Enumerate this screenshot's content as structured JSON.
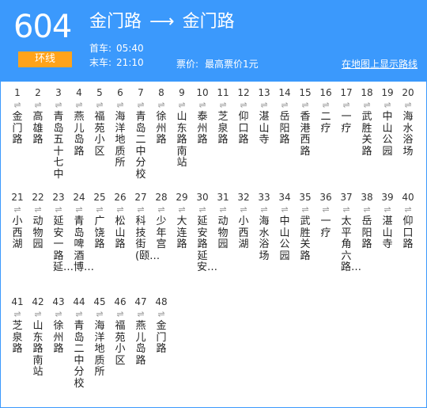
{
  "route": {
    "number": "604",
    "type_badge": "环线",
    "from": "金门路",
    "to": "金门路",
    "arrow": "⟶",
    "first_label": "首车:",
    "first_time": "05:40",
    "last_label": "末车:",
    "last_time": "21:10",
    "fare_label": "票价:",
    "fare_value": "最高票价1元",
    "map_link": "在地图上显示路线"
  },
  "direction_symbol": "⇌",
  "colors": {
    "header_bg": "#3b99fc",
    "badge_bg": "#ffa31a"
  },
  "stops": [
    {
      "n": "1",
      "name": "金门路"
    },
    {
      "n": "2",
      "name": "高雄路"
    },
    {
      "n": "3",
      "name": "青岛五十七中"
    },
    {
      "n": "4",
      "name": "燕儿岛路"
    },
    {
      "n": "5",
      "name": "福苑小区"
    },
    {
      "n": "6",
      "name": "海洋地质所"
    },
    {
      "n": "7",
      "name": "青岛二中分校"
    },
    {
      "n": "8",
      "name": "徐州路"
    },
    {
      "n": "9",
      "name": "山东路南站"
    },
    {
      "n": "10",
      "name": "泰州路"
    },
    {
      "n": "11",
      "name": "芝泉路"
    },
    {
      "n": "12",
      "name": "仰口路"
    },
    {
      "n": "13",
      "name": "湛山寺"
    },
    {
      "n": "14",
      "name": "岳阳路"
    },
    {
      "n": "15",
      "name": "香港西路"
    },
    {
      "n": "16",
      "name": "二疗"
    },
    {
      "n": "17",
      "name": "一疗"
    },
    {
      "n": "18",
      "name": "武胜关路"
    },
    {
      "n": "19",
      "name": "中山公园"
    },
    {
      "n": "20",
      "name": "海水浴场"
    },
    {
      "n": "21",
      "name": "小西湖"
    },
    {
      "n": "22",
      "name": "动物园"
    },
    {
      "n": "23",
      "name": "延安一路延…"
    },
    {
      "n": "24",
      "name": "青岛啤酒博…"
    },
    {
      "n": "25",
      "name": "广饶路"
    },
    {
      "n": "26",
      "name": "松山路"
    },
    {
      "n": "27",
      "name": "科技街(颐…"
    },
    {
      "n": "28",
      "name": "少年宫"
    },
    {
      "n": "29",
      "name": "大连路"
    },
    {
      "n": "30",
      "name": "延安路延安…"
    },
    {
      "n": "31",
      "name": "动物园"
    },
    {
      "n": "32",
      "name": "小西湖"
    },
    {
      "n": "33",
      "name": "海水浴场"
    },
    {
      "n": "34",
      "name": "中山公园"
    },
    {
      "n": "35",
      "name": "武胜关路"
    },
    {
      "n": "36",
      "name": "一疗"
    },
    {
      "n": "37",
      "name": "太平角六路…"
    },
    {
      "n": "38",
      "name": "岳阳路"
    },
    {
      "n": "39",
      "name": "湛山寺"
    },
    {
      "n": "40",
      "name": "仰口路"
    },
    {
      "n": "41",
      "name": "芝泉路"
    },
    {
      "n": "42",
      "name": "山东路南站"
    },
    {
      "n": "43",
      "name": "徐州路"
    },
    {
      "n": "44",
      "name": "青岛二中分校"
    },
    {
      "n": "45",
      "name": "海洋地质所"
    },
    {
      "n": "46",
      "name": "福苑小区"
    },
    {
      "n": "47",
      "name": "燕儿岛路"
    },
    {
      "n": "48",
      "name": "金门路"
    }
  ]
}
